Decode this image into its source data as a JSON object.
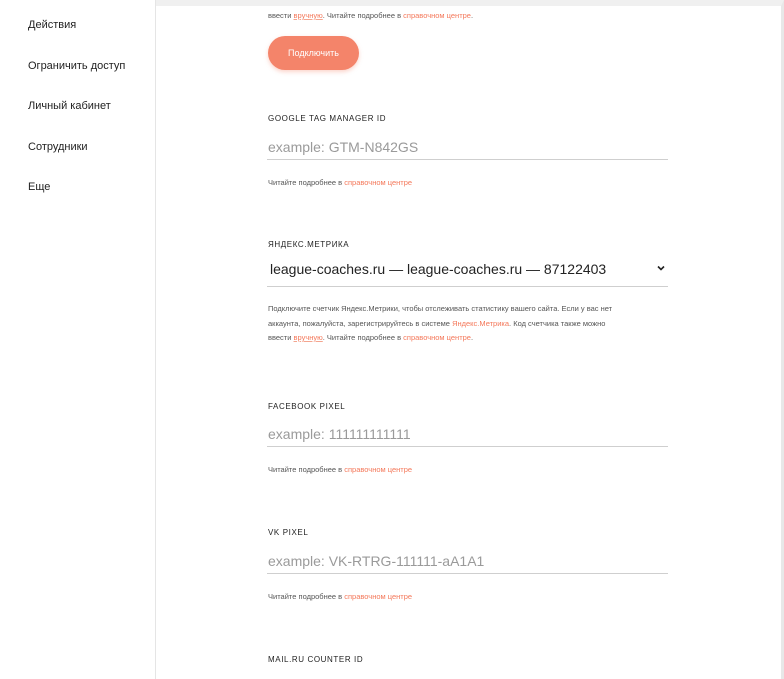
{
  "sidebar": {
    "items": [
      {
        "label": "Действия"
      },
      {
        "label": "Ограничить доступ"
      },
      {
        "label": "Личный кабинет"
      },
      {
        "label": "Сотрудники"
      },
      {
        "label": "Еще"
      }
    ]
  },
  "top_help": {
    "prefix": "ввести ",
    "link1": "вручную",
    "middle": ". Читайте подробнее в ",
    "link2": "справочном центре",
    "suffix": "."
  },
  "connect_button": {
    "label": "Подключить"
  },
  "gtm": {
    "label": "GOOGLE TAG MANAGER ID",
    "placeholder": "example: GTM-N842GS",
    "help_text": "Читайте подробнее в ",
    "help_link": "справочном центре"
  },
  "metrika": {
    "label": "ЯНДЕКС.МЕТРИКА",
    "selected": "league-coaches.ru — league-coaches.ru — 87122403",
    "help_line1": "Подключите счетчик Яндекс.Метрики, чтобы отслеживать статистику вашего сайта. Если у вас нет",
    "help_line2_a": "аккаунта, пожалуйста, зарегистрируйтесь в системе ",
    "help_line2_link": "Яндекс.Метрика",
    "help_line2_b": ". Код счетчика также можно",
    "help_line3_a": "ввести ",
    "help_line3_link1": "вручную",
    "help_line3_b": ". Читайте подробнее в ",
    "help_line3_link2": "справочном центре",
    "help_line3_c": "."
  },
  "facebook": {
    "label": "FACEBOOK PIXEL",
    "placeholder": "example: 111111111111",
    "help_text": "Читайте подробнее в ",
    "help_link": "справочном центре"
  },
  "vk": {
    "label": "VK PIXEL",
    "placeholder": "example: VK-RTRG-111111-aA1A1",
    "help_text": "Читайте подробнее в ",
    "help_link": "справочном центре"
  },
  "mailru": {
    "label": "MAIL.RU COUNTER ID"
  },
  "colors": {
    "accent": "#f4846a",
    "link": "#f4785a"
  }
}
